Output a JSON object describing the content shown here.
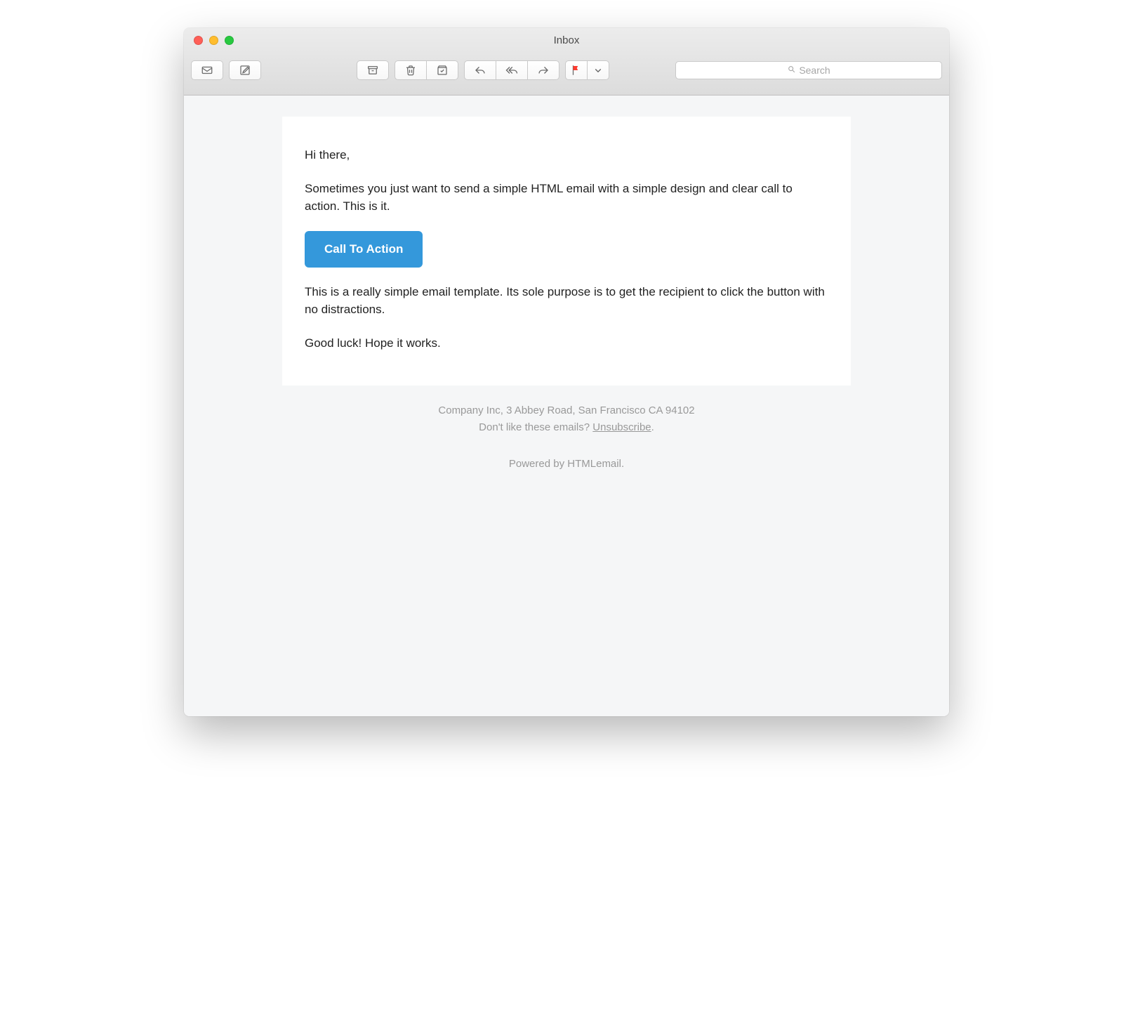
{
  "window": {
    "title": "Inbox"
  },
  "search": {
    "placeholder": "Search"
  },
  "toolbar": {
    "icons": {
      "mailboxes": "mailboxes-icon",
      "compose": "compose-icon",
      "archive": "archive-icon",
      "delete": "trash-icon",
      "junk": "junk-icon",
      "reply": "reply-icon",
      "reply_all": "reply-all-icon",
      "forward": "forward-icon",
      "flag": "flag-icon",
      "flag_dropdown": "chevron-down-icon"
    }
  },
  "email": {
    "greeting": "Hi there,",
    "intro": "Sometimes you just want to send a simple HTML email with a simple design and clear call to action. This is it.",
    "cta_label": "Call To Action",
    "body2": "This is a really simple email template. Its sole purpose is to get the recipient to click the button with no distractions.",
    "closing": "Good luck! Hope it works."
  },
  "footer": {
    "address": "Company Inc, 3 Abbey Road, San Francisco CA 94102",
    "unsubscribe_prefix": "Don't like these emails? ",
    "unsubscribe_link": "Unsubscribe",
    "unsubscribe_suffix": ".",
    "powered_prefix": "Powered by ",
    "powered_brand": "HTMLemail",
    "powered_suffix": "."
  },
  "colors": {
    "cta_bg": "#3498db",
    "cta_fg": "#ffffff",
    "footer_text": "#999999"
  }
}
